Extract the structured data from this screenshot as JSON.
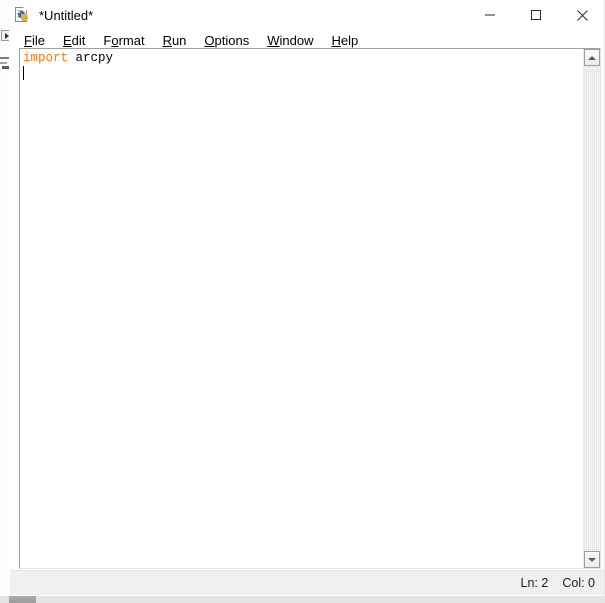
{
  "window": {
    "title": "*Untitled*",
    "icon": "python-file-icon",
    "caption_buttons": [
      {
        "name": "minimize-button",
        "glyph": "minimize-icon",
        "label": "Minimize"
      },
      {
        "name": "maximize-button",
        "glyph": "maximize-icon",
        "label": "Maximize"
      },
      {
        "name": "close-button",
        "glyph": "close-icon",
        "label": "Close"
      }
    ]
  },
  "menubar": {
    "items": [
      {
        "label": "File",
        "mnemonic": "F"
      },
      {
        "label": "Edit",
        "mnemonic": "E"
      },
      {
        "label": "Format",
        "mnemonic": "o"
      },
      {
        "label": "Run",
        "mnemonic": "R"
      },
      {
        "label": "Options",
        "mnemonic": "O"
      },
      {
        "label": "Window",
        "mnemonic": "W"
      },
      {
        "label": "Help",
        "mnemonic": "H"
      }
    ]
  },
  "editor": {
    "lines": [
      {
        "tokens": [
          {
            "text": "import",
            "type": "keyword"
          },
          {
            "text": " arcpy",
            "type": "plain"
          }
        ]
      },
      {
        "tokens": []
      }
    ],
    "caret_line": 2,
    "caret_col": 0
  },
  "scrollbar": {
    "up_arrow": "scroll-up-icon",
    "down_arrow": "scroll-down-icon"
  },
  "statusbar": {
    "line_label": "Ln: 2",
    "col_label": "Col: 0"
  },
  "colors": {
    "keyword": "#ff7700",
    "text": "#000000",
    "window_bg": "#ffffff",
    "status_bg": "#f0f0f0",
    "border": "#a0a0a0"
  }
}
